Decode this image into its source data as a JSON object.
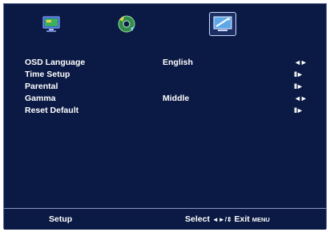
{
  "tabs": [
    {
      "name": "picture-tab",
      "icon": "tv-monitor-icon",
      "selected": false
    },
    {
      "name": "audio-tab",
      "icon": "sound-disc-icon",
      "selected": false
    },
    {
      "name": "setup-tab",
      "icon": "setup-screen-icon",
      "selected": true
    }
  ],
  "menu": {
    "items": [
      {
        "label": "OSD Language",
        "value": "English",
        "arrow": "◄►"
      },
      {
        "label": "Time Setup",
        "value": "",
        "arrow": "II►"
      },
      {
        "label": "Parental",
        "value": "",
        "arrow": "II►"
      },
      {
        "label": "Gamma",
        "value": "Middle",
        "arrow": "◄►"
      },
      {
        "label": "Reset Default",
        "value": "",
        "arrow": "II►"
      }
    ]
  },
  "footer": {
    "page_name": "Setup",
    "select_label": "Select",
    "nav_glyphs": "◄►/⇕",
    "exit_label": "Exit",
    "menu_key": "MENU"
  },
  "colors": {
    "background": "#0b1a44",
    "text": "#ffffff",
    "divider": "#8a98c0"
  }
}
